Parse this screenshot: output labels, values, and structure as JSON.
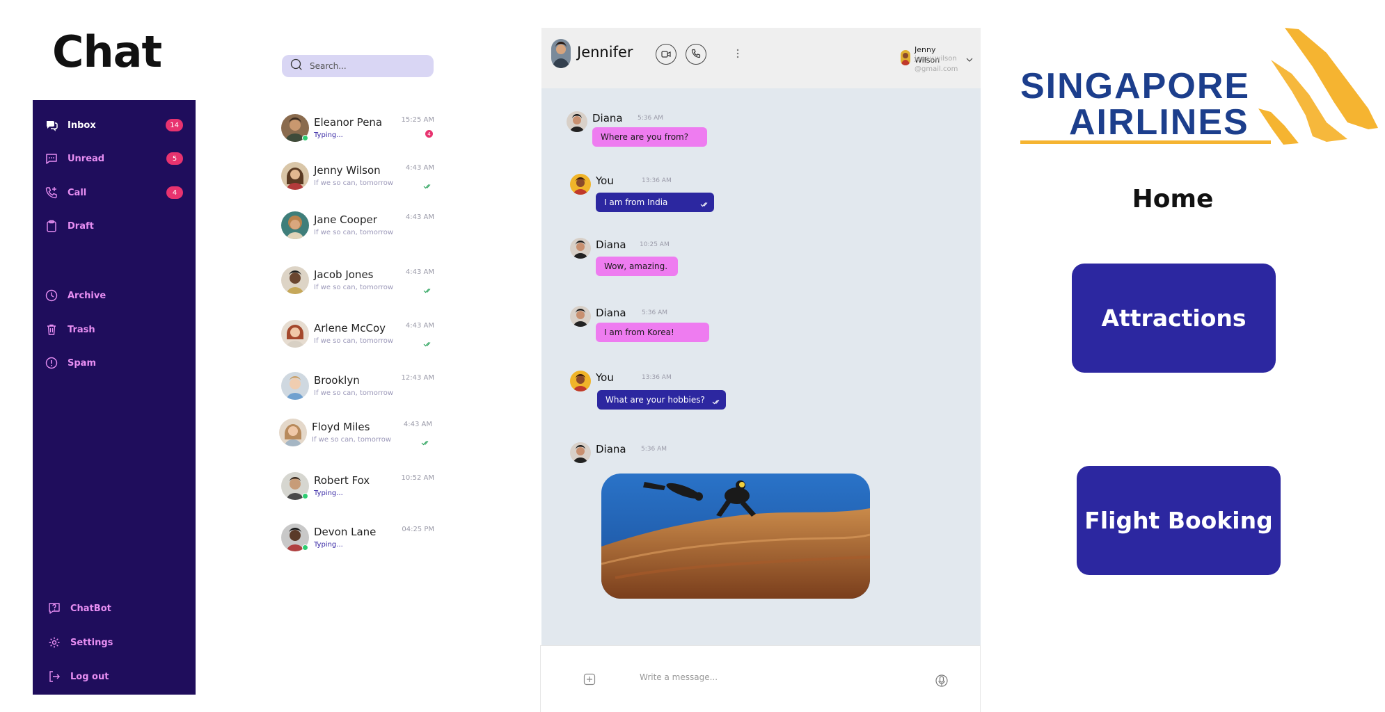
{
  "page": {
    "title": "Chat"
  },
  "sidebar": {
    "items": [
      {
        "label": "Inbox",
        "icon": "chat-bubbles-icon",
        "badge": "14"
      },
      {
        "label": "Unread",
        "icon": "message-square-icon",
        "badge": "5"
      },
      {
        "label": "Call",
        "icon": "phone-add-icon",
        "badge": "4"
      },
      {
        "label": "Draft",
        "icon": "clipboard-icon"
      },
      {
        "label": "Archive",
        "icon": "clock-icon"
      },
      {
        "label": "Trash",
        "icon": "trash-icon"
      },
      {
        "label": "Spam",
        "icon": "alert-circle-icon"
      }
    ],
    "bottom_items": [
      {
        "label": "ChatBot",
        "icon": "chatbot-icon"
      },
      {
        "label": "Settings",
        "icon": "gear-icon"
      },
      {
        "label": "Log out",
        "icon": "logout-icon"
      }
    ]
  },
  "search": {
    "placeholder": "Search..."
  },
  "contacts": [
    {
      "name": "Eleanor Pena",
      "sub": "Typing...",
      "time": "15:25 AM",
      "unread": "4",
      "typing": true
    },
    {
      "name": "Jenny Wilson",
      "sub": "If we so can, tomorrow",
      "time": "4:43 AM",
      "read": true
    },
    {
      "name": "Jane Cooper",
      "sub": "If we so can, tomorrow",
      "time": "4:43 AM"
    },
    {
      "name": "Jacob Jones",
      "sub": "If we so can, tomorrow",
      "time": "4:43 AM",
      "read": true
    },
    {
      "name": "Arlene McCoy",
      "sub": "If we so can, tomorrow",
      "time": "4:43 AM",
      "read": true
    },
    {
      "name": "Brooklyn",
      "sub": "If we so can, tomorrow",
      "time": "12:43 AM"
    },
    {
      "name": "Floyd Miles",
      "sub": "If we so can, tomorrow",
      "time": "4:43 AM",
      "read": true
    },
    {
      "name": "Robert Fox",
      "sub": "Typing...",
      "time": "10:52 AM",
      "typing": true
    },
    {
      "name": "Devon Lane",
      "sub": "Typing...",
      "time": "04:25 PM",
      "typing": true
    }
  ],
  "chat": {
    "header": {
      "name": "Jennifer",
      "user_name": "Jenny Wilson",
      "user_email": "jenny.wilson@gmail.com"
    },
    "messages": [
      {
        "sender": "Diana",
        "time": "5:36 AM",
        "text": "Where are you from?"
      },
      {
        "sender": "You",
        "time": "13:36 AM",
        "text": "I am from India"
      },
      {
        "sender": "Diana",
        "time": "10:25 AM",
        "text": "Wow, amazing."
      },
      {
        "sender": "Diana",
        "time": "5:36 AM",
        "text": "I am from Korea!"
      },
      {
        "sender": "You",
        "time": "13:36 AM",
        "text": "What are your hobbies?"
      },
      {
        "sender": "Diana",
        "time": "5:36 AM",
        "text": ""
      }
    ],
    "composer": {
      "placeholder": "Write a message..."
    }
  },
  "brand": {
    "line1": "SINGAPORE",
    "line2": "AIRLINES",
    "colors": {
      "blue": "#1c3e8c",
      "gold": "#f5b431"
    }
  },
  "right": {
    "title": "Home",
    "buttons": [
      "Attractions",
      "Flight Booking"
    ]
  },
  "colors": {
    "sidebar": "#1f0d5c",
    "accent_pink": "#ee7cf0",
    "accent_blue": "#2c27a0",
    "badge": "#e8336f"
  }
}
